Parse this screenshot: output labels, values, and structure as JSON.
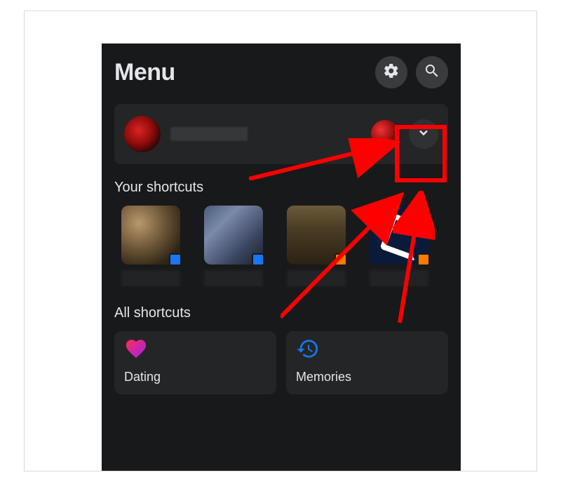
{
  "header": {
    "title": "Menu",
    "settings_icon": "gear",
    "search_icon": "magnifier"
  },
  "profile_card": {
    "chevron_icon": "chevron-down"
  },
  "sections": {
    "your_shortcuts_label": "Your shortcuts",
    "all_shortcuts_label": "All shortcuts"
  },
  "all_shortcuts": {
    "tiles": [
      {
        "label": "Dating",
        "icon": "heart"
      },
      {
        "label": "Memories",
        "icon": "clock-rewind"
      }
    ]
  },
  "annotation": {
    "highlight_target": "profile-chevron"
  }
}
